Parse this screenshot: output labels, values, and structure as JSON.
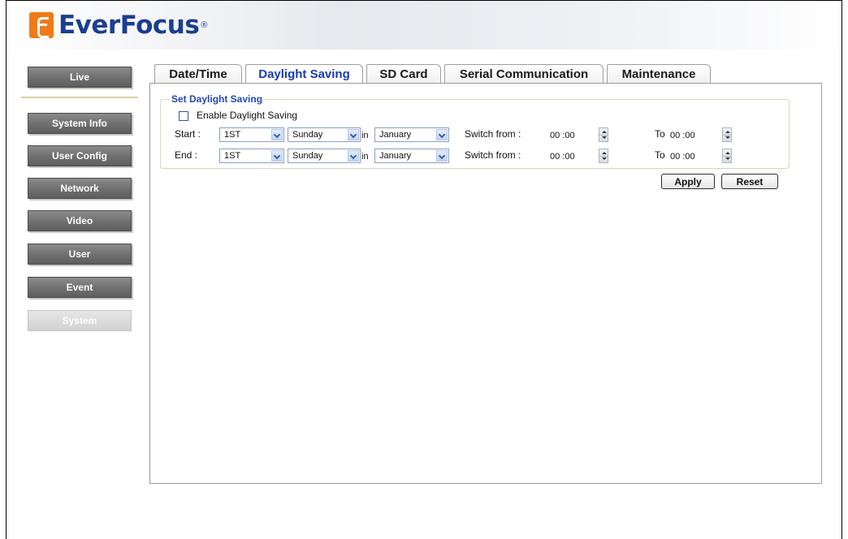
{
  "brand": {
    "name": "EverFocus",
    "reg": "®"
  },
  "sidebar": {
    "items": [
      {
        "label": "Live"
      },
      {
        "label": "System Info"
      },
      {
        "label": "User Config"
      },
      {
        "label": "Network"
      },
      {
        "label": "Video"
      },
      {
        "label": "User"
      },
      {
        "label": "Event"
      },
      {
        "label": "System"
      }
    ]
  },
  "tabs": [
    {
      "label": "Date/Time"
    },
    {
      "label": "Daylight Saving"
    },
    {
      "label": "SD Card"
    },
    {
      "label": "Serial Communication"
    },
    {
      "label": "Maintenance"
    }
  ],
  "form": {
    "group_title": "Set Daylight Saving",
    "enable_label": "Enable Daylight Saving",
    "enable_checked": false,
    "in_label": "in",
    "switch_from_label": "Switch from :",
    "to_label": "To",
    "start": {
      "label": "Start :",
      "week": "1ST",
      "day": "Sunday",
      "month": "January",
      "from": "00 :00",
      "to": "00 :00"
    },
    "end": {
      "label": "End :",
      "week": "1ST",
      "day": "Sunday",
      "month": "January",
      "from": "00 :00",
      "to": "00 :00"
    }
  },
  "buttons": {
    "apply": "Apply",
    "reset": "Reset"
  },
  "colors": {
    "active_tab": "#1b39b4",
    "logo_blue": "#1b3e8f",
    "logo_orange": "#f07a18",
    "group_title": "#2249b7"
  }
}
